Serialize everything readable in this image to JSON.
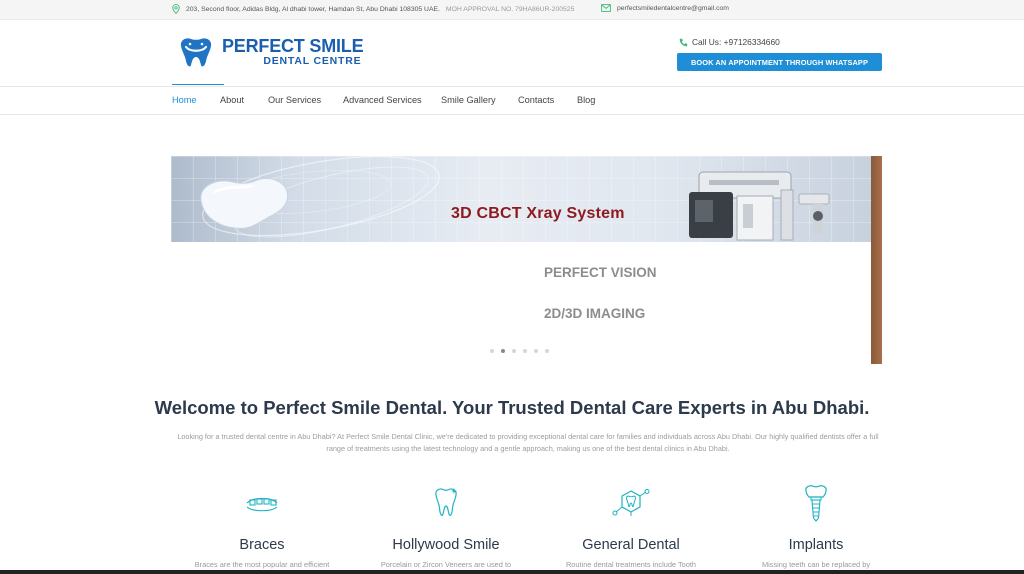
{
  "topbar": {
    "address": "203, Second floor, Adidas Bldg, Al dhabi tower, Hamdan St, Abu Dhabi 108305 UAE.",
    "moh": "MOH APPROVAL NO. 79HA86UR-200525",
    "email": "perfectsmiledentalcentre@gmail.com"
  },
  "header": {
    "logo_line1": "PERFECT SMILE",
    "logo_line2": "DENTAL CENTRE",
    "call": "Call Us: +97126334660",
    "whatsapp_button": "BOOK AN APPOINTMENT THROUGH WHATSAPP"
  },
  "nav": {
    "items": [
      "Home",
      "About",
      "Our Services",
      "Advanced Services",
      "Smile Gallery",
      "Contacts",
      "Blog"
    ],
    "active": "Home"
  },
  "slider": {
    "banner_title": "3D CBCT Xray System",
    "line2": "PERFECT VISION",
    "line3": "2D/3D IMAGING",
    "slide_count": 5,
    "active_slide": 2
  },
  "welcome": {
    "heading": "Welcome to Perfect Smile Dental. Your Trusted Dental Care Experts in Abu Dhabi.",
    "intro": "Looking for a trusted dental centre in Abu Dhabi? At Perfect Smile Dental Clinic, we're dedicated to providing exceptional dental care for families and individuals across Abu Dhabi. Our highly qualified dentists offer a full range of treatments using the latest technology and a gentle approach, making us one of the best dental clinics in Abu Dhabi."
  },
  "services": [
    {
      "name": "Braces",
      "desc": "Braces are the most popular and efficient",
      "icon": "braces-icon"
    },
    {
      "name": "Hollywood Smile",
      "desc": "Porcelain or Zircon Veneers are used to",
      "icon": "sparkle-tooth-icon"
    },
    {
      "name": "General Dental",
      "desc": "Routine dental treatments include Tooth",
      "icon": "tooth-molecule-icon"
    },
    {
      "name": "Implants",
      "desc": "Missing teeth can be replaced by",
      "icon": "implant-icon"
    }
  ],
  "colors": {
    "accent": "#1e8fd6",
    "brand": "#1a5fae",
    "banner_title": "#8e1a1f",
    "heading": "#2d3a4b"
  }
}
